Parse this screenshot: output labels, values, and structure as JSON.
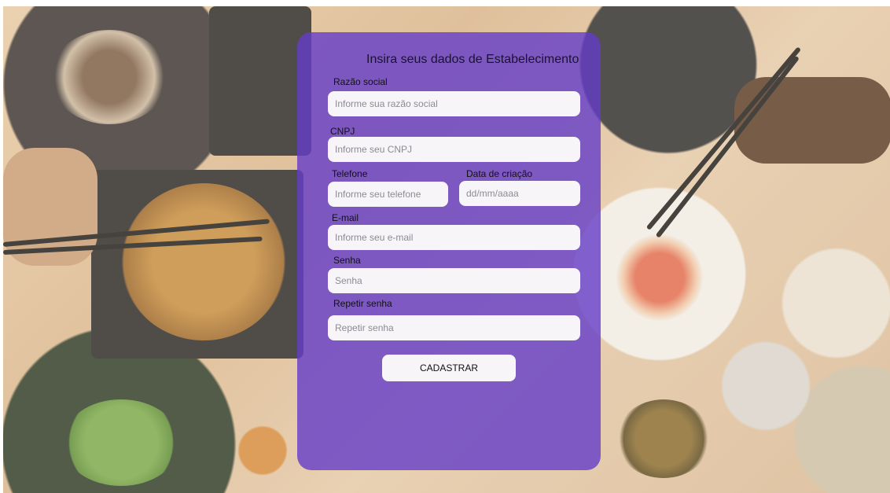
{
  "form": {
    "title": "Insira seus dados de Estabelecimento",
    "fields": {
      "razao_social": {
        "label": "Razão social",
        "placeholder": "Informe sua razão social",
        "value": ""
      },
      "cnpj": {
        "label": "CNPJ",
        "placeholder": "Informe seu CNPJ",
        "value": ""
      },
      "telefone": {
        "label": "Telefone",
        "placeholder": "Informe seu telefone",
        "value": ""
      },
      "data_criacao": {
        "label": "Data de criação",
        "placeholder": "dd/mm/aaaa",
        "value": ""
      },
      "email": {
        "label": "E-mail",
        "placeholder": "Informe seu e-mail",
        "value": ""
      },
      "senha": {
        "label": "Senha",
        "placeholder": "Senha",
        "value": ""
      },
      "repetir_senha": {
        "label": "Repetir senha",
        "placeholder": "Repetir senha",
        "value": ""
      }
    },
    "submit_label": "CADASTRAR"
  },
  "colors": {
    "card_background": "#643cc8",
    "input_background": "#f7f5f8",
    "page_background": "#e0c29c"
  }
}
